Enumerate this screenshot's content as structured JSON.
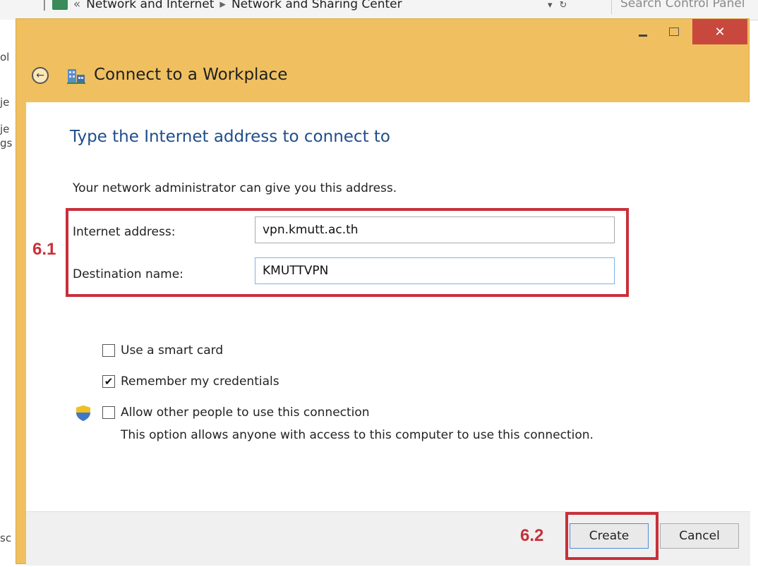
{
  "background": {
    "breadcrumb": [
      "Network and Internet",
      "Network and Sharing Center"
    ],
    "search_placeholder": "Search Control Panel",
    "sidebar_fragments": [
      "ol",
      "je",
      "je",
      "gs",
      "sc"
    ]
  },
  "dialog": {
    "title": "Connect to a Workplace",
    "close_glyph": "✕",
    "back_glyph": "←",
    "heading": "Type the Internet address to connect to",
    "subtext": "Your network administrator can give you this address.",
    "internet_address_label": "Internet address:",
    "internet_address_value": "vpn.kmutt.ac.th",
    "destination_name_label": "Destination name:",
    "destination_name_value": "KMUTTVPN",
    "options": [
      {
        "label": "Use a smart card",
        "checked": false
      },
      {
        "label": "Remember my credentials",
        "checked": true
      },
      {
        "label": "Allow other people to use this connection",
        "checked": false
      }
    ],
    "allow_note": "This option allows anyone with access to this computer to use this connection.",
    "create_label": "Create",
    "cancel_label": "Cancel"
  },
  "annotations": {
    "step_1": "6.1",
    "step_2": "6.2"
  },
  "colors": {
    "dialog_frame": "#f0c060",
    "close_button": "#c9483e",
    "heading": "#1f4e8a",
    "annotation": "#c8303a"
  }
}
